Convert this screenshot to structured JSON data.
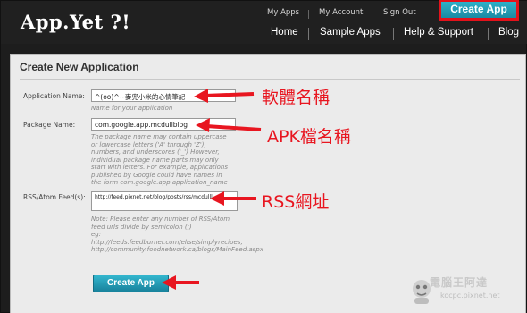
{
  "header": {
    "logo": "App.Yet ?!",
    "top_links": [
      "My Apps",
      "My Account",
      "Sign Out"
    ],
    "create_app_label": "Create App",
    "main_nav": [
      "Home",
      "Sample Apps",
      "Help & Support",
      "Blog"
    ]
  },
  "form": {
    "title": "Create New Application",
    "app_name": {
      "label": "Application Name:",
      "value": "^(oo)^~麥兜小米的心情筆記",
      "help": "Name for your application"
    },
    "package_name": {
      "label": "Package Name:",
      "value": "com.google.app.mcdullblog",
      "help": [
        "The package name may contain uppercase",
        "or lowercase letters ('A' through 'Z'),",
        "numbers, and underscores ('_') However,",
        "individual package name parts may only",
        "start with letters. For example, applications",
        "published by Google could have names in",
        "the form com.google.app.application_name"
      ]
    },
    "feeds": {
      "label": "RSS/Atom Feed(s):",
      "value": "http://feed.pixnet.net/blog/posts/rss/mcdullll",
      "help": [
        "Note: Please enter any number of RSS/Atom",
        "feed urls divide by semicolon (;)",
        "eg:",
        "http://feeds.feedburner.com/elise/simplyrecipes;",
        "http://community.foodnetwork.ca/blogs/MainFeed.aspx"
      ]
    },
    "submit_label": "Create App"
  },
  "annotations": {
    "app_name": "軟體名稱",
    "package_name": "APK檔名稱",
    "feeds": "RSS網址"
  },
  "watermark": {
    "text": "電腦王阿達",
    "url": "kocpc.pixnet.net"
  },
  "colors": {
    "accent": "#1f97b2",
    "annotation_red": "#e81620",
    "header_bg": "#202020"
  }
}
